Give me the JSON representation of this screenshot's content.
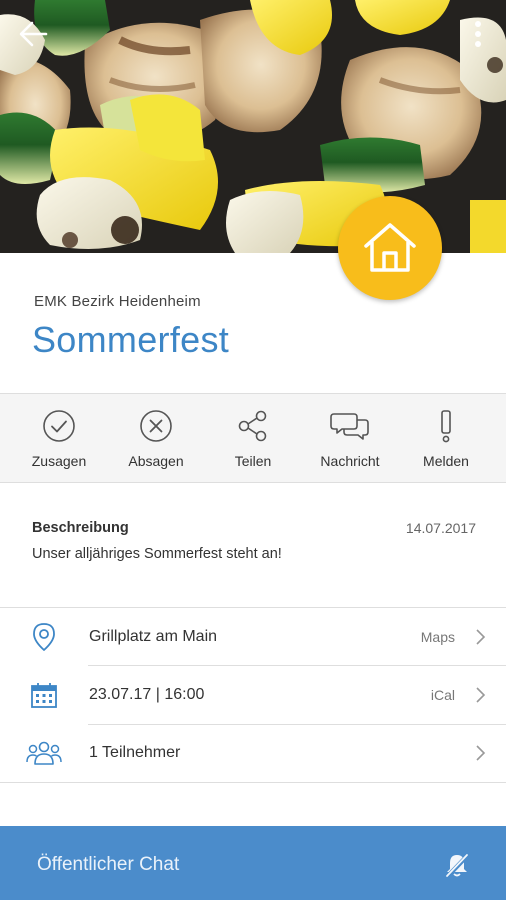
{
  "hero": {
    "back_icon": "arrow-left-icon",
    "more_icon": "more-vertical-icon",
    "badge_icon": "home-icon",
    "badge_color": "#f8bd1b"
  },
  "event": {
    "organizer": "EMK Bezirk Heidenheim",
    "title": "Sommerfest"
  },
  "actions": [
    {
      "label": "Zusagen",
      "icon": "check-circle-icon"
    },
    {
      "label": "Absagen",
      "icon": "x-circle-icon"
    },
    {
      "label": "Teilen",
      "icon": "share-icon"
    },
    {
      "label": "Nachricht",
      "icon": "chat-bubbles-icon"
    },
    {
      "label": "Melden",
      "icon": "exclamation-icon"
    }
  ],
  "description": {
    "heading": "Beschreibung",
    "date": "14.07.2017",
    "text": "Unser alljähriges Sommerfest steht an!"
  },
  "info_rows": [
    {
      "icon": "map-pin-icon",
      "text": "Grillplatz am Main",
      "link": "Maps"
    },
    {
      "icon": "calendar-icon",
      "text": "23.07.17 | 16:00",
      "link": "iCal"
    },
    {
      "icon": "participants-icon",
      "text": "1 Teilnehmer",
      "link": ""
    }
  ],
  "chat": {
    "label": "Öffentlicher Chat",
    "icon": "bell-off-icon"
  },
  "colors": {
    "accent_blue": "#3d86c6",
    "chat_bar": "#4b8ccb",
    "badge_yellow": "#f8bd1b"
  }
}
